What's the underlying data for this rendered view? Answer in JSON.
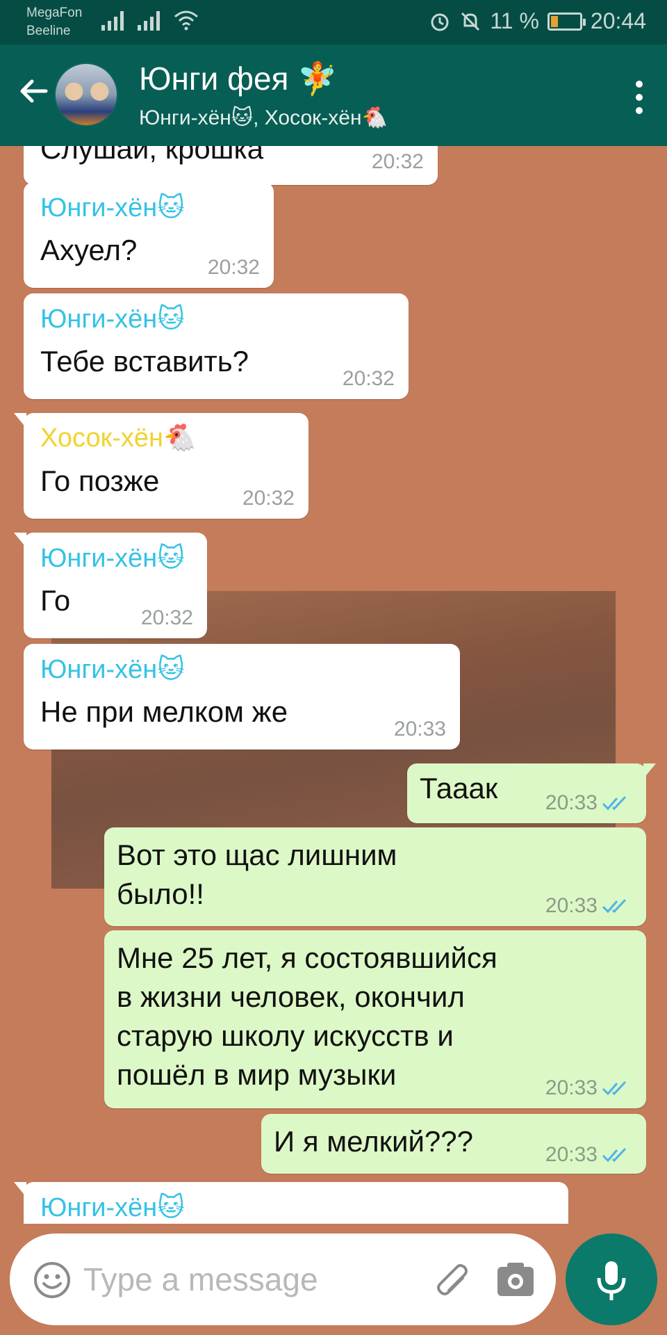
{
  "status_bar": {
    "carrier_1": "MegaFon",
    "carrier_2": "Beeline",
    "battery": "11 %",
    "time": "20:44"
  },
  "header": {
    "title": "Юнги фея 🧚",
    "members": "Юнги-хён🐱, Хосок-хён🐔"
  },
  "messages": [
    {
      "direction": "in",
      "sender": "",
      "text": "Слушай, крошка",
      "time": "20:32"
    },
    {
      "direction": "in",
      "sender": "Юнги-хён🐱",
      "text": "Ахуел?",
      "time": "20:32"
    },
    {
      "direction": "in",
      "sender": "Юнги-хён🐱",
      "text": "Тебе вставить?",
      "time": "20:32"
    },
    {
      "direction": "in",
      "sender": "Хосок-хён🐔",
      "text": "Го позже",
      "time": "20:32"
    },
    {
      "direction": "in",
      "sender": "Юнги-хён🐱",
      "text": "Го",
      "time": "20:32"
    },
    {
      "direction": "in",
      "sender": "Юнги-хён🐱",
      "text": "Не при мелком же",
      "time": "20:33"
    },
    {
      "direction": "out",
      "sender": "",
      "text": "Тааак",
      "time": "20:33"
    },
    {
      "direction": "out",
      "sender": "",
      "text": "Вот это щас лишним\nбыло!!",
      "time": "20:33"
    },
    {
      "direction": "out",
      "sender": "",
      "text": "Мне 25 лет, я состоявшийся\nв жизни человек, окончил\nстарую школу искусств и\nпошёл в мир музыки",
      "time": "20:33"
    },
    {
      "direction": "out",
      "sender": "",
      "text": "И я мелкий???",
      "time": "20:33"
    },
    {
      "direction": "in",
      "sender": "Юнги-хён🐱",
      "text": "",
      "time": ""
    }
  ],
  "sender_colors": {
    "Юнги-хён": "#35c2e6",
    "Хосок-хён": "#f2d22e"
  },
  "input": {
    "placeholder": "Type a message"
  },
  "icons": {
    "back": "arrow-left-icon",
    "more": "more-vertical-icon",
    "emoji": "smiley-icon",
    "attach": "paperclip-icon",
    "camera": "camera-icon",
    "mic": "microphone-icon",
    "read": "double-check-icon"
  }
}
